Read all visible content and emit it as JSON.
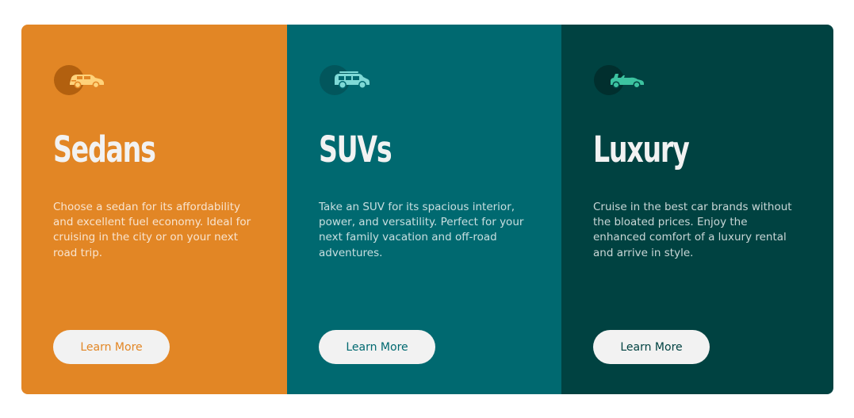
{
  "cards": [
    {
      "icon": "sedan-car-icon",
      "title": "Sedans",
      "description": "Choose a sedan for its affordability and excellent fuel economy. Ideal for cruising in the city or on your next road trip.",
      "button_label": "Learn More",
      "background_color": "#e28625"
    },
    {
      "icon": "suv-car-icon",
      "title": "SUVs",
      "description": "Take an SUV for its spacious interior, power, and versatility. Perfect for your next family vacation and off-road adventures.",
      "button_label": "Learn More",
      "background_color": "#006970"
    },
    {
      "icon": "luxury-convertible-icon",
      "title": "Luxury",
      "description": "Cruise in the best car brands without the bloated prices. Enjoy the enhanced comfort of a luxury rental and arrive in style.",
      "button_label": "Learn More",
      "background_color": "#004241"
    }
  ],
  "colors": {
    "button_background": "#f2f2f2",
    "heading_text": "#f2f2f2",
    "page_background": "#ffffff"
  }
}
